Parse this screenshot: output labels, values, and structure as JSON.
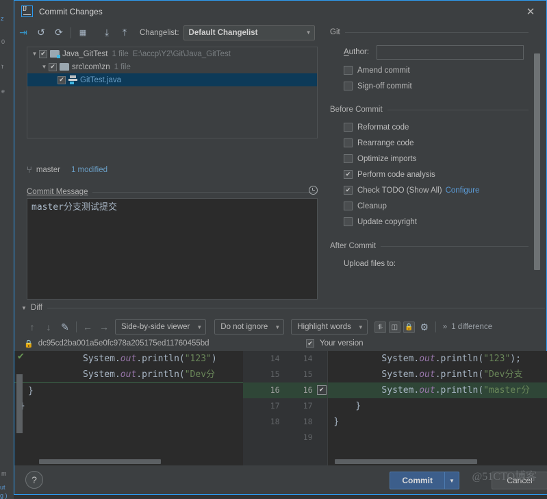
{
  "window": {
    "title": "Commit Changes",
    "logo_icon": "intellij-idea-logo",
    "close_icon": "✕"
  },
  "background": {
    "fragments": [
      "z",
      "0",
      "ז",
      "e",
      "m",
      "ut",
      "g )"
    ]
  },
  "toolbar": {
    "icons": [
      {
        "name": "rollback-icon",
        "glyph": "⇥"
      },
      {
        "name": "undo-icon",
        "glyph": "↺"
      },
      {
        "name": "refresh-icon",
        "glyph": "⟳"
      },
      {
        "name": "group-by-icon",
        "glyph": "▦"
      },
      {
        "name": "expand-all-icon",
        "glyph": "⤓"
      },
      {
        "name": "collapse-all-icon",
        "glyph": "⤒"
      }
    ],
    "changelist_label": "Changelist:",
    "changelist_value": "Default Changelist",
    "caret": "▼"
  },
  "file_tree": {
    "rows": [
      {
        "level": 0,
        "triangle": "▼",
        "checked": true,
        "icon": "modified-folder-icon",
        "name": "Java_GitTest",
        "count": "1 file",
        "path": "E:\\accp\\Y2\\Git\\Java_GitTest",
        "selected": false,
        "modified": false
      },
      {
        "level": 1,
        "triangle": "▼",
        "checked": true,
        "icon": "folder-icon",
        "name": "src\\com\\zn",
        "count": "1 file",
        "path": "",
        "selected": false,
        "modified": false
      },
      {
        "level": 2,
        "triangle": "",
        "checked": true,
        "icon": "java-file-icon",
        "name": "GitTest.java",
        "count": "",
        "path": "",
        "selected": true,
        "modified": true
      }
    ]
  },
  "branch_bar": {
    "branch_icon": "git-branch-icon",
    "branch": "master",
    "modified": "1 modified"
  },
  "commit_message": {
    "label": "Commit Message",
    "history_icon": "clock-icon",
    "value": "master分支测试提交"
  },
  "git_group": {
    "title": "Git",
    "author_label": "Author:",
    "author_value": "",
    "checkboxes": [
      {
        "label": "Amend commit",
        "checked": false
      },
      {
        "label": "Sign-off commit",
        "checked": false
      }
    ]
  },
  "before_commit": {
    "title": "Before Commit",
    "checkboxes": [
      {
        "label": "Reformat code",
        "checked": false,
        "link": ""
      },
      {
        "label": "Rearrange code",
        "checked": false,
        "link": ""
      },
      {
        "label": "Optimize imports",
        "checked": false,
        "link": ""
      },
      {
        "label": "Perform code analysis",
        "checked": true,
        "link": ""
      },
      {
        "label": "Check TODO (Show All)",
        "checked": true,
        "link": "Configure"
      },
      {
        "label": "Cleanup",
        "checked": false,
        "link": ""
      },
      {
        "label": "Update copyright",
        "checked": false,
        "link": ""
      }
    ]
  },
  "after_commit": {
    "title": "After Commit",
    "upload_label": "Upload files to:"
  },
  "diff": {
    "section_title": "Diff",
    "section_triangle": "▼",
    "nav_icons": [
      {
        "name": "previous-difference-icon",
        "glyph": "↑"
      },
      {
        "name": "next-difference-icon",
        "glyph": "↓"
      },
      {
        "name": "edit-source-icon",
        "glyph": "✎"
      },
      {
        "name": "apply-left-icon",
        "glyph": "←"
      },
      {
        "name": "apply-right-icon",
        "glyph": "→"
      }
    ],
    "viewer_mode": "Side-by-side viewer",
    "ignore_mode": "Do not ignore",
    "highlight_mode": "Highlight words",
    "square_icons": [
      {
        "name": "collapse-unchanged-icon",
        "glyph": "⥮"
      },
      {
        "name": "show-whitespace-icon",
        "glyph": "◫"
      },
      {
        "name": "read-only-lock-icon",
        "glyph": "🔒"
      },
      {
        "name": "diff-settings-gear-icon",
        "glyph": "⚙"
      }
    ],
    "more_glyph": "»",
    "difference_count": "1 difference",
    "revision_lock_icon": "lock-icon",
    "revision_hash": "dc95cd2ba001a5e0fc978a205175ed11760455bd",
    "your_version_label": "Your version",
    "your_version_checked": true,
    "left_lines": [
      {
        "num_a": "14",
        "num_b": "14",
        "text": "        System.out.println(\"123\")",
        "added": false
      },
      {
        "num_a": "15",
        "num_b": "15",
        "text": "        System.out.println(\"Dev分",
        "added": false
      },
      {
        "num_a": "16",
        "num_b": "16",
        "text": "    }",
        "added": false,
        "current": true
      },
      {
        "num_a": "17",
        "num_b": "17",
        "text": "}",
        "added": false
      },
      {
        "num_a": "18",
        "num_b": "18",
        "text": "",
        "added": false
      },
      {
        "num_a": "",
        "num_b": "19",
        "text": "",
        "added": false
      }
    ],
    "right_lines": [
      {
        "text": "        System.out.println(\"123\");",
        "added": false
      },
      {
        "text": "        System.out.println(\"Dev分支",
        "added": false
      },
      {
        "text": "        System.out.println(\"master分",
        "added": true
      },
      {
        "text": "    }",
        "added": false
      },
      {
        "text": "}",
        "added": false
      }
    ],
    "accepted_marker": "✔"
  },
  "footer": {
    "help_label": "?",
    "commit_label": "Commit",
    "commit_caret": "▼",
    "cancel_label": "Cancel",
    "watermark": "@51CTO博客"
  },
  "colors": {
    "accent_blue": "#2d9bf0",
    "link_blue": "#5b9ad4",
    "commit_button": "#3c5e8b",
    "added_line": "#2f4637",
    "selection": "#0d3a58"
  }
}
